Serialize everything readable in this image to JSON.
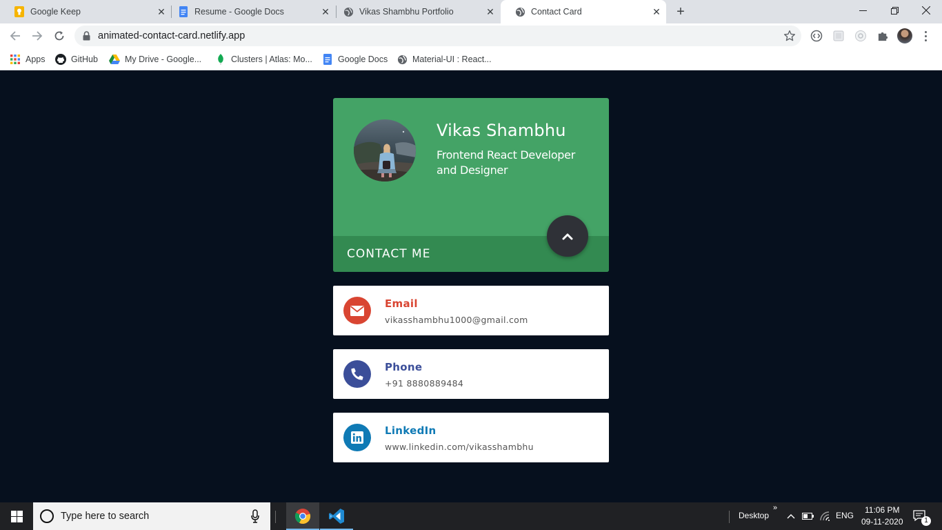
{
  "browser": {
    "tabs": [
      {
        "title": "Google Keep",
        "icon": "google-keep-icon",
        "active": false
      },
      {
        "title": "Resume - Google Docs",
        "icon": "google-docs-icon",
        "active": false
      },
      {
        "title": "Vikas Shambhu Portfolio",
        "icon": "globe-icon",
        "active": false
      },
      {
        "title": "Contact Card",
        "icon": "globe-icon",
        "active": true
      }
    ],
    "url": "animated-contact-card.netlify.app",
    "bookmarks": [
      {
        "label": "Apps",
        "icon": "apps-grid-icon"
      },
      {
        "label": "GitHub",
        "icon": "github-icon"
      },
      {
        "label": "My Drive - Google...",
        "icon": "google-drive-icon"
      },
      {
        "label": "Clusters | Atlas: Mo...",
        "icon": "mongodb-leaf-icon"
      },
      {
        "label": "Google Docs",
        "icon": "google-docs-icon"
      },
      {
        "label": "Material-UI : React...",
        "icon": "globe-icon"
      }
    ]
  },
  "card": {
    "name": "Vikas Shambhu",
    "role": "Frontend React Developer and Designer",
    "contact_title": "CONTACT ME",
    "colors": {
      "header": "#44a366",
      "footer": "#338a51",
      "button": "#2f3137"
    }
  },
  "contacts": [
    {
      "label": "Email",
      "value": "vikasshambhu1000@gmail.com",
      "color": "#d94532",
      "icon": "envelope-icon"
    },
    {
      "label": "Phone",
      "value": "+91 8880889484",
      "color": "#3b4e99",
      "icon": "phone-icon"
    },
    {
      "label": "LinkedIn",
      "value": "www.linkedin.com/vikasshambhu",
      "color": "#0f7ab5",
      "icon": "linkedin-icon"
    }
  ],
  "taskbar": {
    "search_placeholder": "Type here to search",
    "desktop_label": "Desktop",
    "language": "ENG",
    "time": "11:06 PM",
    "date": "09-11-2020",
    "notification_count": "1"
  }
}
